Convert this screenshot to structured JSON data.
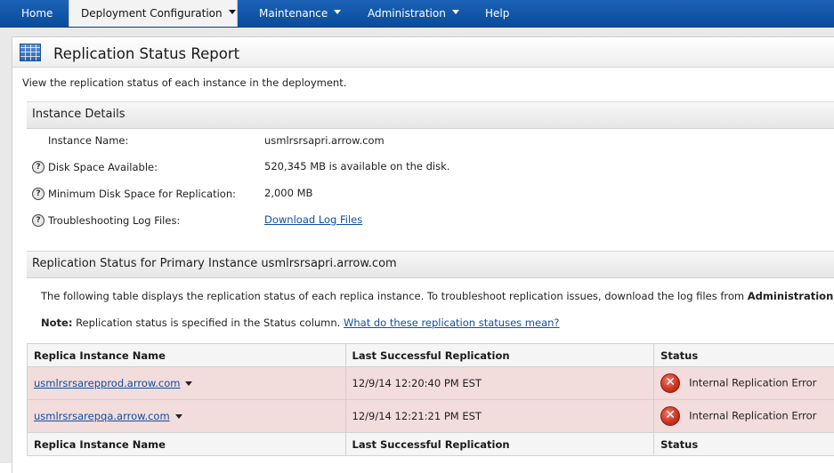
{
  "nav": {
    "items": [
      {
        "label": "Home",
        "has_menu": false,
        "active": false
      },
      {
        "label": "Deployment Configuration",
        "has_menu": true,
        "active": true
      },
      {
        "label": "Maintenance",
        "has_menu": true,
        "active": false
      },
      {
        "label": "Administration",
        "has_menu": true,
        "active": false
      },
      {
        "label": "Help",
        "has_menu": false,
        "active": false
      }
    ]
  },
  "page": {
    "title": "Replication Status Report",
    "intro": "View the replication status of each instance in the deployment."
  },
  "instance_details": {
    "heading": "Instance Details",
    "rows": [
      {
        "label": "Instance Name:",
        "value": "usmlrsrsapri.arrow.com",
        "help_icon": false
      },
      {
        "label": "Disk Space Available:",
        "value": "520,345 MB is available on the disk.",
        "help_icon": true
      },
      {
        "label": "Minimum Disk Space for Replication:",
        "value": "2,000 MB",
        "help_icon": true
      },
      {
        "label": "Troubleshooting Log Files:",
        "value": "Download Log Files",
        "help_icon": true,
        "is_link": true
      }
    ]
  },
  "replication": {
    "heading": "Replication Status for Primary Instance usmlrsrsapri.arrow.com",
    "description_prefix": "The following table displays the replication status of each replica instance. To troubleshoot replication issues, download the log files from ",
    "description_bold": "Administration >",
    "note_label": "Note:",
    "note_text": " Replication status is specified in the Status column. ",
    "note_link": "What do these replication statuses mean?",
    "table": {
      "columns": [
        "Replica Instance Name",
        "Last Successful Replication",
        "Status"
      ],
      "rows": [
        {
          "instance": "usmlrsrsarepprod.arrow.com",
          "last": "12/9/14 12:20:40 PM EST",
          "status": "Internal Replication Error",
          "status_icon": "error-icon"
        },
        {
          "instance": "usmlrsrsarepqa.arrow.com",
          "last": "12/9/14 12:21:21 PM EST",
          "status": "Internal Replication Error",
          "status_icon": "error-icon"
        }
      ],
      "footer_columns": [
        "Replica Instance Name",
        "Last Successful Replication",
        "Status"
      ]
    }
  },
  "colors": {
    "nav_blue": "#0a4c9c",
    "error_row": "#f2dcdc",
    "link": "#0e4fa1"
  }
}
